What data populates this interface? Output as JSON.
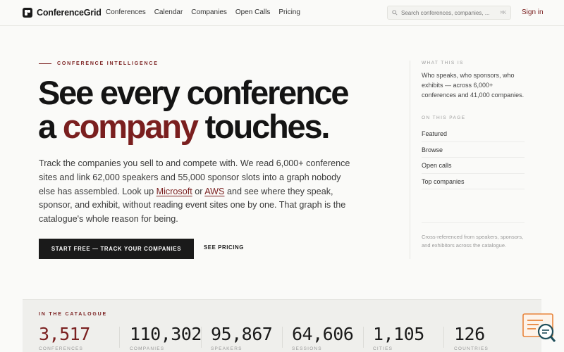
{
  "brand": {
    "name": "ConferenceGrid"
  },
  "nav": {
    "links": [
      "Conferences",
      "Calendar",
      "Companies",
      "Open Calls",
      "Pricing"
    ],
    "signin": "Sign in"
  },
  "search": {
    "placeholder": "Search conferences, companies, ...",
    "shortcut": "⌘K"
  },
  "hero": {
    "eyebrow": "CONFERENCE INTELLIGENCE",
    "line1": "See every conference",
    "line2_a": "a ",
    "line2_accent": "company",
    "line2_b": " touches.",
    "body_1": "Track the companies you sell to and compete with. We read 6,000+ conference sites and link 62,000 speakers and 55,000 sponsor slots into a graph nobody else has assembled. Look up ",
    "link_1": "Microsoft",
    "body_2": " or ",
    "link_2": "AWS",
    "body_3": " and see where they speak, sponsor, and exhibit, without reading event sites one by one. That graph is the catalogue's whole reason for being.",
    "cta_primary": "START FREE — TRACK YOUR COMPANIES",
    "cta_secondary": "SEE PRICING"
  },
  "aside": {
    "what_h": "WHAT THIS IS",
    "what_p": "Who speaks, who sponsors, who exhibits — across 6,000+ conferences and 41,000 companies.",
    "toc_h": "ON THIS PAGE",
    "toc": [
      "Featured",
      "Browse",
      "Open calls",
      "Top companies"
    ],
    "foot": "Cross-referenced from speakers, sponsors, and exhibitors across the catalogue."
  },
  "stats": {
    "heading": "IN THE CATALOGUE",
    "items": [
      {
        "value": "3,517",
        "label": "CONFERENCES"
      },
      {
        "value": "110,302",
        "label": "COMPANIES"
      },
      {
        "value": "95,867",
        "label": "SPEAKERS"
      },
      {
        "value": "64,606",
        "label": "SESSIONS"
      },
      {
        "value": "1,105",
        "label": "CITIES"
      },
      {
        "value": "126",
        "label": "COUNTRIES"
      }
    ]
  },
  "colors": {
    "accent": "#7a1f1f",
    "ink": "#1a1a1a",
    "bg": "#fafaf8",
    "fab": "#e8843a"
  },
  "icons": {
    "search": "search-icon",
    "logo": "grid-logo-icon",
    "fab": "search-chat-icon"
  }
}
